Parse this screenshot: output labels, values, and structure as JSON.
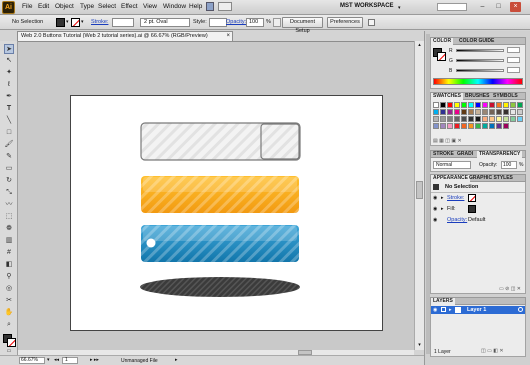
{
  "menubar": {
    "logo": "Ai",
    "items": [
      "File",
      "Edit",
      "Object",
      "Type",
      "Select",
      "Effect",
      "View",
      "Window",
      "Help"
    ],
    "workspace": "MST WORKSPACE"
  },
  "controlbar": {
    "selection_label": "No Selection",
    "stroke_label": "Stroke:",
    "brush_value": "2 pt. Oval",
    "style_label": "Style:",
    "opacity_label": "Opacity:",
    "opacity_value": "100",
    "opacity_unit": "%",
    "document_setup": "Document Setup",
    "preferences": "Preferences"
  },
  "document": {
    "tab_title": "Web 2.0 Buttons Tutorial (Web 2 tutorial series).ai @ 66.67% (RGB/Preview)"
  },
  "statusbar": {
    "zoom": "66.67%",
    "page": "1",
    "status": "Unmanaged File"
  },
  "color_panel": {
    "tabs": [
      "COLOR",
      "COLOR GUIDE"
    ],
    "channels": [
      "R",
      "G",
      "B"
    ]
  },
  "swatches_panel": {
    "tabs": [
      "SWATCHES",
      "BRUSHES",
      "SYMBOLS"
    ],
    "colors": [
      "#ffffff",
      "#000000",
      "#ff0000",
      "#ffff00",
      "#00ff00",
      "#00ffff",
      "#0000ff",
      "#ff00ff",
      "#c8102e",
      "#f47920",
      "#fff200",
      "#8dc63f",
      "#00a651",
      "#00aeef",
      "#2e3192",
      "#92278f",
      "#ec008c",
      "#603913",
      "#a67c52",
      "#c7b299",
      "#998675",
      "#736357",
      "#534741",
      "#362f2d",
      "#e6e6e6",
      "#cccccc",
      "#b3b3b3",
      "#999999",
      "#808080",
      "#666666",
      "#4d4d4d",
      "#333333",
      "#1a1a1a",
      "#f9ad81",
      "#fdc68a",
      "#fff799",
      "#c4df9b",
      "#82ca9c",
      "#6dcff6",
      "#8393ca",
      "#a187be",
      "#f49ac1",
      "#ed1c24",
      "#f26522",
      "#f7941d",
      "#39b54a",
      "#00a99d",
      "#0072bc",
      "#662d91",
      "#9e005d"
    ]
  },
  "stroke_panel": {
    "tabs": [
      "STROKE",
      "GRADI",
      "TRANSPARENCY"
    ],
    "blend_mode": "Normal",
    "opacity_label": "Opacity:",
    "opacity_value": "100",
    "opacity_unit": "%"
  },
  "appearance_panel": {
    "tabs": [
      "APPEARANCE",
      "GRAPHIC STYLES"
    ],
    "header": "No Selection",
    "rows": [
      {
        "label": "Stroke:",
        "link": true
      },
      {
        "label": "Fill:",
        "link": false
      },
      {
        "label": "Opacity:",
        "value": "Default",
        "link": true
      }
    ]
  },
  "layers_panel": {
    "tabs": [
      "LAYERS"
    ],
    "layers": [
      {
        "name": "Layer 1"
      }
    ],
    "footer": "1 Layer"
  },
  "artwork": {
    "colors": {
      "orange_top": "#ffc02e",
      "orange_bottom": "#f29a11",
      "blue_top": "#3fa6d8",
      "blue_bottom": "#1176ab",
      "shadow": "#3b3b3b",
      "accent_tab": "#2c6bd4"
    }
  },
  "icons": [
    "ai-logo",
    "minimize-icon",
    "maximize-icon",
    "close-icon",
    "selection-tool-icon",
    "direct-selection-tool-icon",
    "pen-tool-icon",
    "type-tool-icon",
    "line-tool-icon",
    "rectangle-tool-icon",
    "brush-tool-icon",
    "pencil-tool-icon",
    "rotate-tool-icon",
    "scale-tool-icon",
    "zoom-tool-icon",
    "hand-tool-icon",
    "fill-swatch-icon",
    "stroke-swatch-icon",
    "eye-icon",
    "lock-icon"
  ]
}
